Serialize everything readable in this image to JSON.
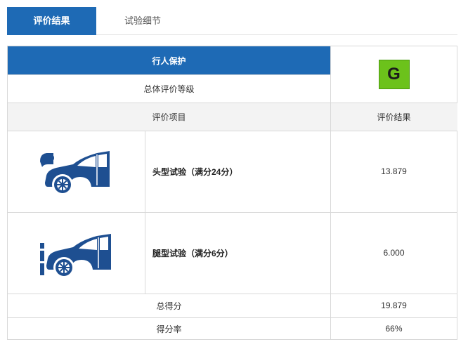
{
  "tabs": [
    {
      "label": "评价结果",
      "active": true
    },
    {
      "label": "试验细节",
      "active": false
    }
  ],
  "summary": {
    "title": "行人保护",
    "overall_label": "总体评价等级",
    "grade": "G",
    "grade_color": "#6cc21b"
  },
  "table_header": {
    "item": "评价项目",
    "result": "评价结果"
  },
  "rows": [
    {
      "icon": "car-head-impact-icon",
      "label": "头型试验（满分24分）",
      "value": "13.879"
    },
    {
      "icon": "car-leg-impact-icon",
      "label": "腿型试验（满分6分）",
      "value": "6.000"
    }
  ],
  "totals": {
    "score_label": "总得分",
    "score_value": "19.879",
    "rate_label": "得分率",
    "rate_value": "66%"
  },
  "colors": {
    "accent": "#1e6ab5",
    "icon": "#1e4f91"
  }
}
